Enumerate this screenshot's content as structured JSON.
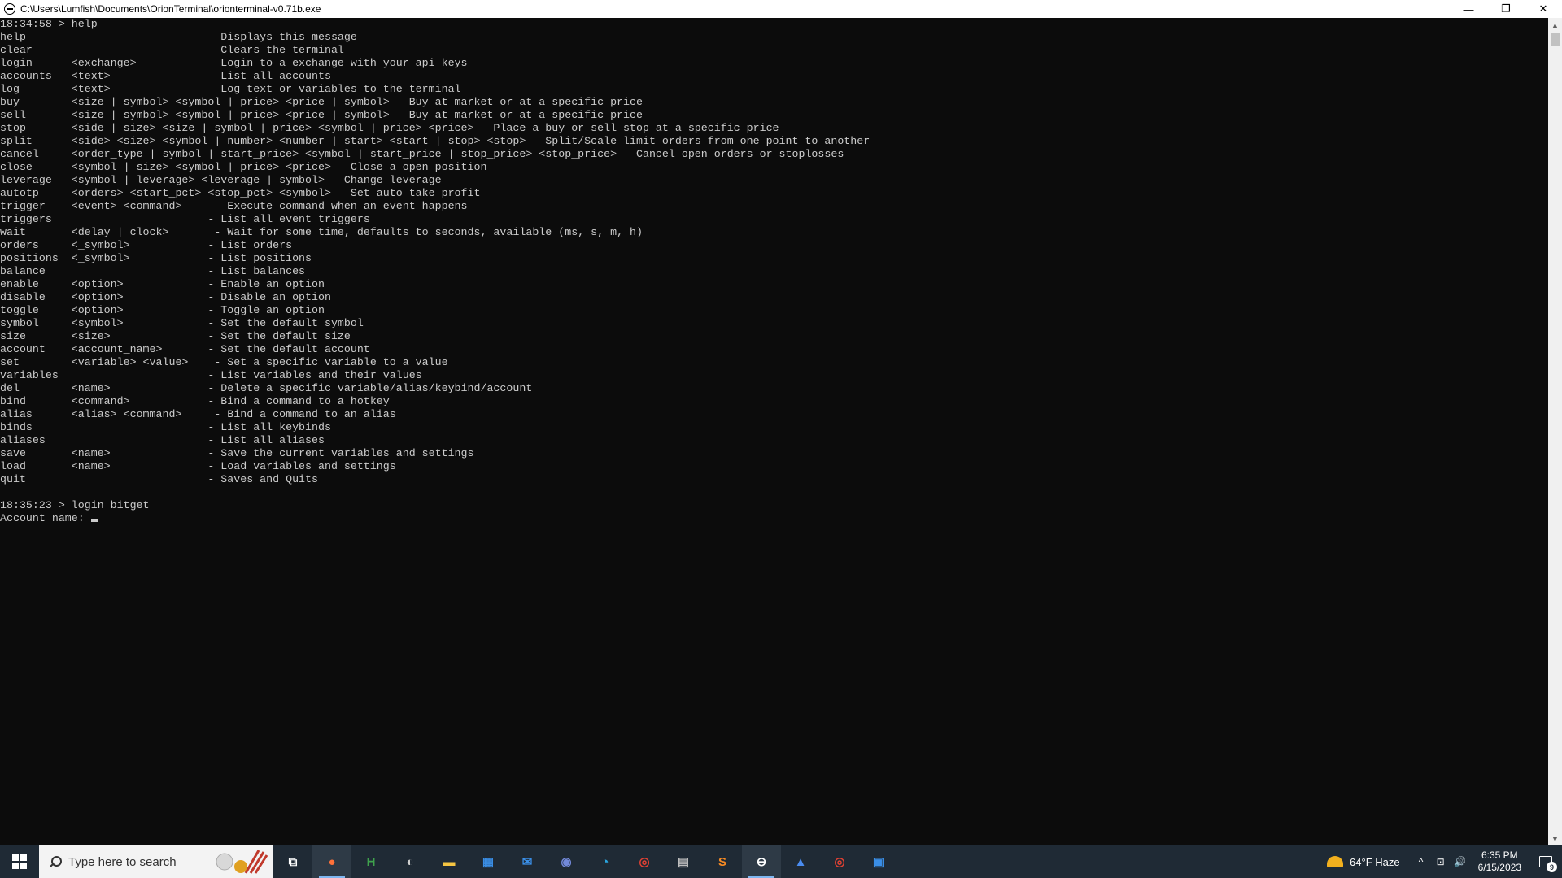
{
  "window": {
    "title": "C:\\Users\\Lumfish\\Documents\\OrionTerminal\\orionterminal-v0.71b.exe",
    "minimize_glyph": "—",
    "restore_glyph": "❐",
    "close_glyph": "✕"
  },
  "terminal": {
    "lines": [
      "18:34:58 > help",
      "help                            - Displays this message",
      "clear                           - Clears the terminal",
      "login      <exchange>           - Login to a exchange with your api keys",
      "accounts   <text>               - List all accounts",
      "log        <text>               - Log text or variables to the terminal",
      "buy        <size | symbol> <symbol | price> <price | symbol> - Buy at market or at a specific price",
      "sell       <size | symbol> <symbol | price> <price | symbol> - Buy at market or at a specific price",
      "stop       <side | size> <size | symbol | price> <symbol | price> <price> - Place a buy or sell stop at a specific price",
      "split      <side> <size> <symbol | number> <number | start> <start | stop> <stop> - Split/Scale limit orders from one point to another",
      "cancel     <order_type | symbol | start_price> <symbol | start_price | stop_price> <stop_price> - Cancel open orders or stoplosses",
      "close      <symbol | size> <symbol | price> <price> - Close a open position",
      "leverage   <symbol | leverage> <leverage | symbol> - Change leverage",
      "autotp     <orders> <start_pct> <stop_pct> <symbol> - Set auto take profit",
      "trigger    <event> <command>     - Execute command when an event happens",
      "triggers                        - List all event triggers",
      "wait       <delay | clock>       - Wait for some time, defaults to seconds, available (ms, s, m, h)",
      "orders     <_symbol>            - List orders",
      "positions  <_symbol>            - List positions",
      "balance                         - List balances",
      "enable     <option>             - Enable an option",
      "disable    <option>             - Disable an option",
      "toggle     <option>             - Toggle an option",
      "symbol     <symbol>             - Set the default symbol",
      "size       <size>               - Set the default size",
      "account    <account_name>       - Set the default account",
      "set        <variable> <value>    - Set a specific variable to a value",
      "variables                       - List variables and their values",
      "del        <name>               - Delete a specific variable/alias/keybind/account",
      "bind       <command>            - Bind a command to a hotkey",
      "alias      <alias> <command>     - Bind a command to an alias",
      "binds                           - List all keybinds",
      "aliases                         - List all aliases",
      "save       <name>               - Save the current variables and settings",
      "load       <name>               - Load variables and settings",
      "quit                            - Saves and Quits",
      "",
      "18:35:23 > login bitget"
    ],
    "prompt": "Account name: "
  },
  "taskbar": {
    "search_placeholder": "Type here to search",
    "apps": [
      {
        "name": "task-view-icon",
        "glyph": "⧉",
        "color": "#ffffff"
      },
      {
        "name": "firefox-icon",
        "glyph": "●",
        "color": "#ff7139",
        "active": true
      },
      {
        "name": "hex-editor-icon",
        "glyph": "H",
        "color": "#3fa34d"
      },
      {
        "name": "obs-icon",
        "glyph": "◐",
        "color": "#d0d0d0"
      },
      {
        "name": "file-explorer-icon",
        "glyph": "▬",
        "color": "#f5c542"
      },
      {
        "name": "microsoft-store-icon",
        "glyph": "▦",
        "color": "#3a8ee6"
      },
      {
        "name": "mail-icon",
        "glyph": "✉",
        "color": "#3a8ee6"
      },
      {
        "name": "discord-icon",
        "glyph": "◉",
        "color": "#7289da"
      },
      {
        "name": "edge-icon",
        "glyph": "◔",
        "color": "#2aa6e0"
      },
      {
        "name": "chrome-icon",
        "glyph": "◎",
        "color": "#e34133"
      },
      {
        "name": "terminal-app-icon",
        "glyph": "▤",
        "color": "#bdbdbd"
      },
      {
        "name": "sublime-text-icon",
        "glyph": "S",
        "color": "#f58a24"
      },
      {
        "name": "orion-terminal-icon",
        "glyph": "⊖",
        "color": "#ffffff",
        "active": true
      },
      {
        "name": "arc-app-icon",
        "glyph": "▲",
        "color": "#4a8cf0"
      },
      {
        "name": "chrome-profile-icon",
        "glyph": "◎",
        "color": "#e34133"
      },
      {
        "name": "window-app-icon",
        "glyph": "▣",
        "color": "#3a8ee6"
      }
    ],
    "weather": "64°F  Haze",
    "tray_chevron": "^",
    "tray_network": "⊡",
    "tray_volume": "🔊",
    "time": "6:35 PM",
    "date": "6/15/2023",
    "notification_count": "9"
  }
}
